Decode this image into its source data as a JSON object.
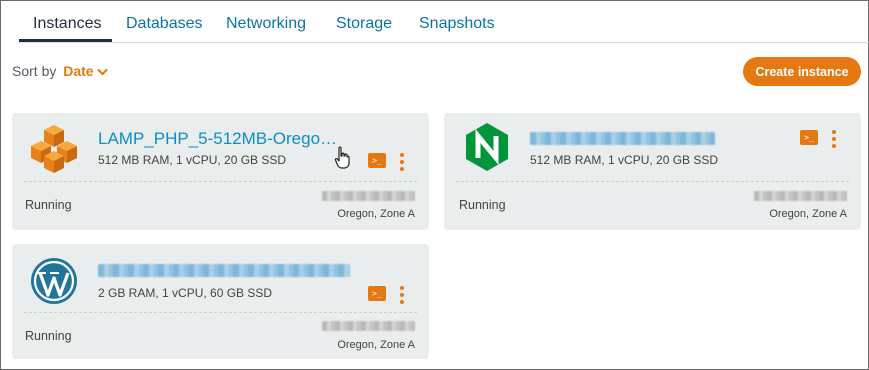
{
  "tabs": [
    {
      "label": "Instances",
      "active": true
    },
    {
      "label": "Databases"
    },
    {
      "label": "Networking"
    },
    {
      "label": "Storage"
    },
    {
      "label": "Snapshots"
    }
  ],
  "sort": {
    "prefix": "Sort by",
    "value": "Date"
  },
  "create_button": "Create instance",
  "colors": {
    "accent": "#e47911",
    "link": "#0b8fc7",
    "card": "#eaeded"
  },
  "instances": [
    {
      "name": "LAMP_PHP_5-512MB-Orego…",
      "specs": "512 MB RAM, 1 vCPU, 20 GB SSD",
      "status": "Running",
      "region": "Oregon, Zone A",
      "icon": "aws-cubes-icon"
    },
    {
      "name": "",
      "specs": "512 MB RAM, 1 vCPU, 20 GB SSD",
      "status": "Running",
      "region": "Oregon, Zone A",
      "icon": "nginx-icon"
    },
    {
      "name": "",
      "specs": "2 GB RAM, 1 vCPU, 60 GB SSD",
      "status": "Running",
      "region": "Oregon, Zone A",
      "icon": "wordpress-icon"
    }
  ],
  "terminal_glyph": ">_"
}
